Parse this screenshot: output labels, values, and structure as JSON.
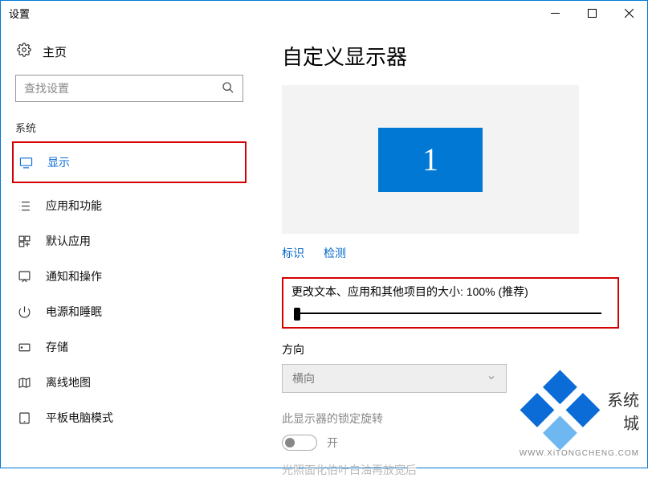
{
  "window": {
    "title": "设置"
  },
  "sidebar": {
    "home": "主页",
    "search_placeholder": "查找设置",
    "category": "系统",
    "items": [
      {
        "label": "显示",
        "icon": "monitor-icon",
        "selected": true
      },
      {
        "label": "应用和功能",
        "icon": "list-icon"
      },
      {
        "label": "默认应用",
        "icon": "defaults-icon"
      },
      {
        "label": "通知和操作",
        "icon": "notifications-icon"
      },
      {
        "label": "电源和睡眠",
        "icon": "power-icon"
      },
      {
        "label": "存储",
        "icon": "storage-icon"
      },
      {
        "label": "离线地图",
        "icon": "map-icon"
      },
      {
        "label": "平板电脑模式",
        "icon": "tablet-icon"
      }
    ]
  },
  "main": {
    "title": "自定义显示器",
    "monitor_number": "1",
    "links": {
      "identify": "标识",
      "detect": "检测"
    },
    "scale_label": "更改文本、应用和其他项目的大小: 100% (推荐)",
    "scale_value": 100,
    "orientation_label": "方向",
    "orientation_value": "横向",
    "lock_label": "此显示器的锁定旋转",
    "toggle_label": "开",
    "toggle_on": false,
    "truncated_text": "光照面化伯叶白油再放宽后"
  },
  "watermark": {
    "text": "系统城",
    "sub": "WWW.XiTONGCHENG.COM"
  }
}
